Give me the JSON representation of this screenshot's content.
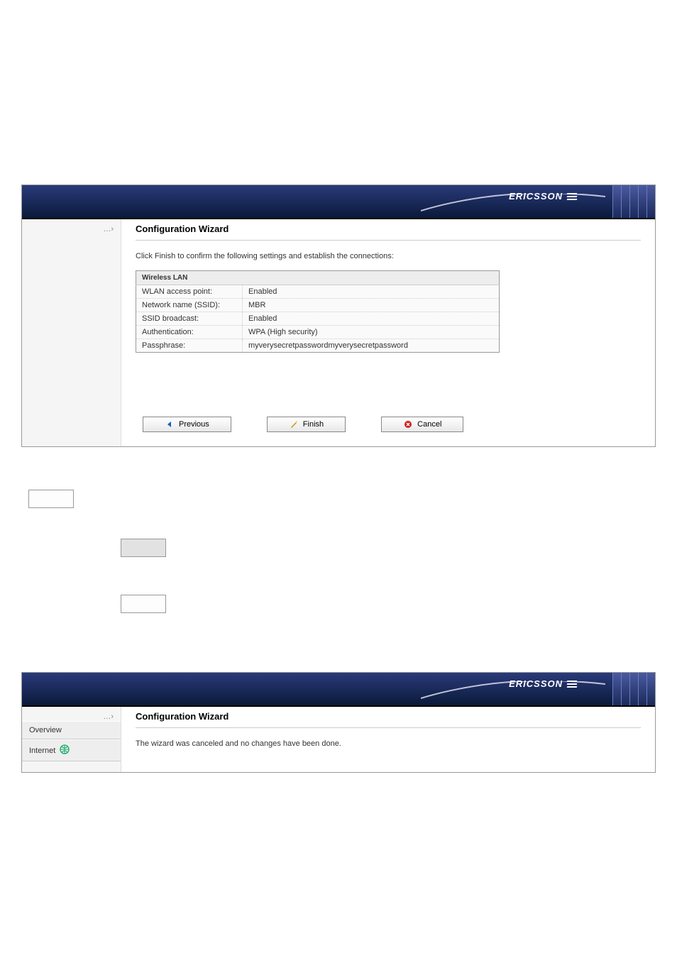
{
  "brand": "ERICSSON",
  "crumb_marker": "…›",
  "wizard1": {
    "title": "Configuration Wizard",
    "instruction": "Click Finish to confirm the following settings and establish the connections:",
    "section_header": "Wireless LAN",
    "rows": [
      {
        "label": "WLAN access point:",
        "value": "Enabled"
      },
      {
        "label": "Network name (SSID):",
        "value": "MBR"
      },
      {
        "label": "SSID broadcast:",
        "value": "Enabled"
      },
      {
        "label": "Authentication:",
        "value": "WPA (High security)"
      },
      {
        "label": "Passphrase:",
        "value": "myverysecretpasswordmyverysecretpassword"
      }
    ],
    "buttons": {
      "previous": "Previous",
      "finish": "Finish",
      "cancel": "Cancel"
    }
  },
  "wizard2": {
    "title": "Configuration Wizard",
    "message": "The wizard was canceled and no changes have been done.",
    "menu": {
      "overview": "Overview",
      "internet": "Internet"
    }
  }
}
